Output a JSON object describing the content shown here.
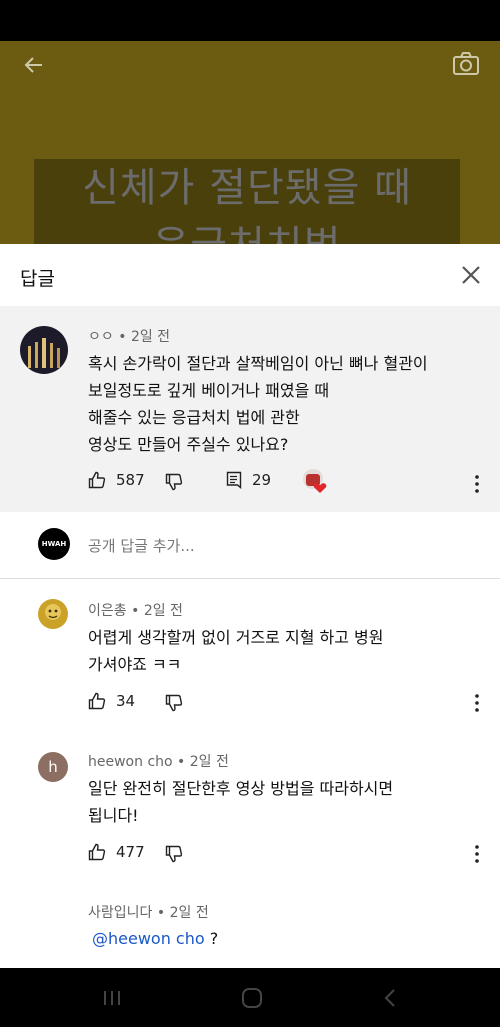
{
  "video": {
    "caption_line1": "신체가 절단됐을 때",
    "caption_line2": "응급처치법"
  },
  "sheet": {
    "title": "답글"
  },
  "parent_comment": {
    "author": "ㅇㅇ",
    "time": "2일 전",
    "lines": [
      "혹시 손가락이 절단과 살짝베임이 아닌 뼈나 혈관이",
      "보일정도로 깊게 베이거나 패였을 때",
      "해줄수 있는 응급처치 법에 관한",
      "영상도 만들어 주실수 있나요?"
    ],
    "likes": "587",
    "replies": "29"
  },
  "reply_box": {
    "avatar_text": "HWAH",
    "placeholder": "공개 답글 추가..."
  },
  "replies": [
    {
      "author": "이은총",
      "time": "2일 전",
      "lines": [
        "어렵게 생각할꺼 없이 거즈로 지혈 하고 병원",
        "가셔야죠 ㅋㅋ"
      ],
      "likes": "34"
    },
    {
      "author": "heewon cho",
      "avatar_letter": "h",
      "time": "2일 전",
      "lines": [
        "일단 완전히 절단한후 영상 방법을 따라하시면",
        "됩니다!"
      ],
      "likes": "477"
    },
    {
      "author": "사람입니다",
      "time": "2일 전",
      "mention": "@heewon cho",
      "text": " ?"
    }
  ],
  "colors": {
    "video_bg": "#6b5c12",
    "highlight_bg": "#f2f2f2",
    "mention": "#1a57c9",
    "heart": "#e0252b"
  }
}
